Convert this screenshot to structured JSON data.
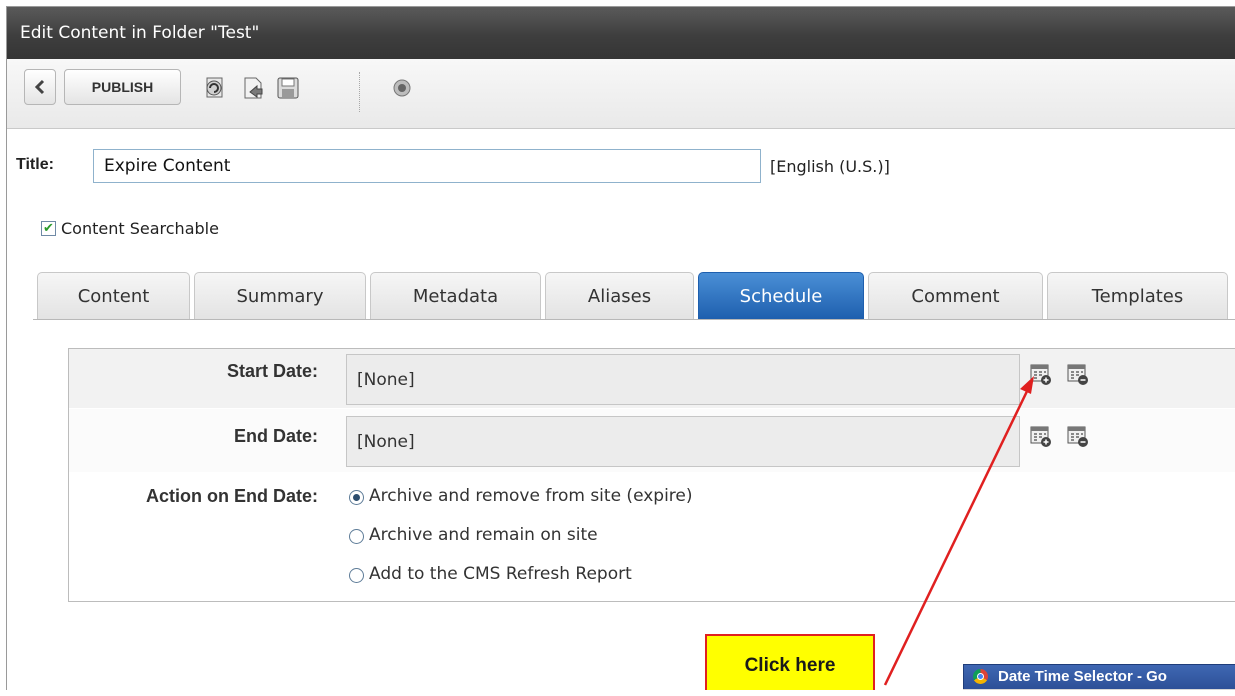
{
  "window": {
    "title": "Edit Content in Folder \"Test\""
  },
  "toolbar": {
    "back_label": "<",
    "publish_label": "PUBLISH",
    "icons": [
      "checkin-icon",
      "preview-icon",
      "save-icon",
      "help-icon"
    ]
  },
  "title_field": {
    "label": "Title:",
    "value": "Expire Content",
    "language": "[English (U.S.)]"
  },
  "searchable": {
    "label": "Content Searchable",
    "checked": true
  },
  "tabs": [
    {
      "label": "Content"
    },
    {
      "label": "Summary"
    },
    {
      "label": "Metadata"
    },
    {
      "label": "Aliases"
    },
    {
      "label": "Schedule",
      "active": true
    },
    {
      "label": "Comment"
    },
    {
      "label": "Templates"
    }
  ],
  "schedule": {
    "start_label": "Start Date:",
    "start_value": "[None]",
    "end_label": "End Date:",
    "end_value": "[None]",
    "action_label": "Action on End Date:",
    "options": [
      {
        "label": "Archive and remove from site (expire)",
        "selected": true
      },
      {
        "label": "Archive and remain on site",
        "selected": false
      },
      {
        "label": "Add to the CMS Refresh Report",
        "selected": false
      }
    ]
  },
  "annotation": {
    "text": "Click here"
  },
  "popup": {
    "title": "Date Time Selector - Go"
  },
  "colors": {
    "accent": "#1e5fae",
    "callout_fill": "#ffff00",
    "callout_border": "#e02020"
  }
}
